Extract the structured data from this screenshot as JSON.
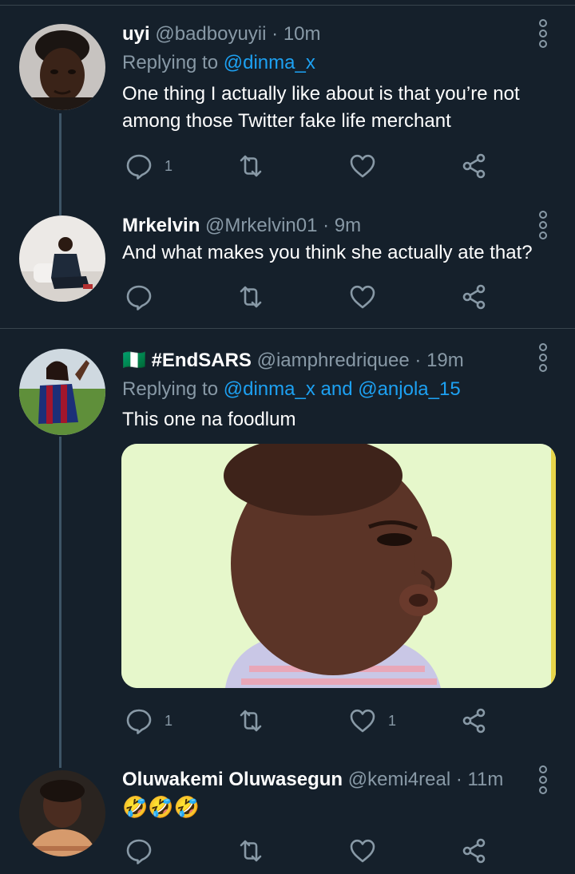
{
  "tweets": [
    {
      "name": "uyi",
      "handle": "@badboyuyii",
      "time": "· 10m",
      "replying_prefix": "Replying to ",
      "replying_to": "@dinma_x",
      "text": "One thing I actually like about is that you’re not among those Twitter fake life merchant",
      "reply_count": "1",
      "retweet_count": "",
      "like_count": ""
    },
    {
      "name": "Mrkelvin",
      "handle": "@Mrkelvin01",
      "time": "· 9m",
      "text": "And what makes you think she actually ate that?",
      "reply_count": "",
      "retweet_count": "",
      "like_count": ""
    },
    {
      "flag": "🇳🇬",
      "name": "#EndSARS",
      "handle": "@iamphredriquee",
      "time": "· 19m",
      "replying_prefix": "Replying to ",
      "replying_to": "@dinma_x",
      "replying_and": " and ",
      "replying_to_2": "@anjola_15",
      "text": "This one na foodlum",
      "reply_count": "1",
      "retweet_count": "",
      "like_count": "1"
    },
    {
      "name": "Oluwakemi Oluwasegun",
      "handle": "@kemi4real",
      "time": "· 11m",
      "text": "🤣🤣🤣",
      "reply_count": "",
      "retweet_count": "",
      "like_count": ""
    }
  ],
  "colors": {
    "background": "#15202b",
    "secondary_text": "#8899a6",
    "link": "#1da1f2",
    "divider": "#38444d"
  },
  "icons": [
    "reply-icon",
    "retweet-icon",
    "like-icon",
    "share-icon",
    "more-icon"
  ]
}
